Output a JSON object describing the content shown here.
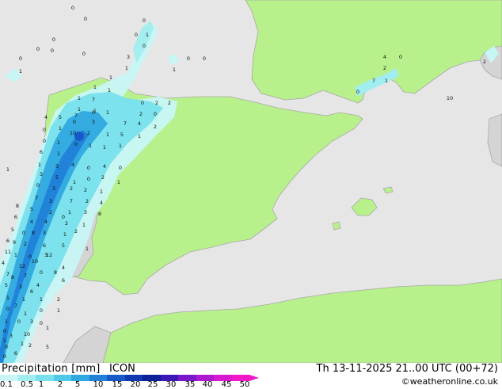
{
  "footer": {
    "title": "Precipitation [mm]",
    "model": "ICON",
    "valid_time": "Th 13-11-2025 21..00 UTC (00+72)",
    "credit": "©weatheronline.co.uk"
  },
  "colorbar": {
    "ticks": [
      "0.1",
      "0.5",
      "1",
      "2",
      "5",
      "10",
      "15",
      "20",
      "25",
      "30",
      "35",
      "40",
      "45",
      "50"
    ],
    "colors": [
      "#c8f5f5",
      "#a0eef0",
      "#78e0ec",
      "#50c8e8",
      "#30a8e0",
      "#2080d8",
      "#1858c8",
      "#1038b0",
      "#0c2098",
      "#3c18b8",
      "#7818c8",
      "#b018d0",
      "#d818d0",
      "#f018c8"
    ]
  },
  "colors": {
    "sea": "#e6e6e6",
    "land_forecast": "#b8f08c",
    "land_outside": "#d4d4d4",
    "coast": "#a8a8a8"
  },
  "map_values": [
    "0",
    "0",
    "0",
    "0",
    "0",
    "0",
    "0",
    "0",
    "0",
    "1",
    "3",
    "0",
    "0",
    "1",
    "0",
    "1",
    "1",
    "4",
    "0",
    "2",
    "0",
    "7",
    "1",
    "10",
    "2",
    "0",
    "2",
    "2",
    "1",
    "1",
    "1",
    "7",
    "1",
    "1",
    "1",
    "0",
    "4",
    "5",
    "7",
    "2",
    "0",
    "0",
    "1",
    "0",
    "3",
    "1",
    "7",
    "4",
    "2",
    "0",
    "1",
    "10",
    "2",
    "1",
    "5",
    "1",
    "6",
    "1",
    "0",
    "1",
    "1",
    "1",
    "1",
    "3",
    "4",
    "0",
    "4",
    "0",
    "1",
    "3",
    "5",
    "1",
    "0",
    "2",
    "1",
    "0",
    "3",
    "2",
    "2",
    "1",
    "8",
    "7",
    "3",
    "7",
    "2",
    "4",
    "6",
    "5",
    "2",
    "1",
    "3",
    "8",
    "5",
    "4",
    "4",
    "2",
    "1",
    "6",
    "0",
    "3",
    "1",
    "11",
    "2",
    "6",
    "5",
    "4",
    "1",
    "0",
    "3",
    "4",
    "7",
    "7",
    "0",
    "8",
    "5",
    "3",
    "4",
    "6",
    "1",
    "2",
    "1",
    "0",
    "1",
    "1",
    "0",
    "0",
    "0",
    "1",
    "0",
    "0",
    "1",
    "1",
    "0",
    "1",
    "1",
    "10",
    "12",
    "8",
    "9",
    "10",
    "12",
    "8",
    "6",
    "7",
    "3",
    "3",
    "2",
    "6",
    "1",
    "5",
    "2",
    "0"
  ]
}
